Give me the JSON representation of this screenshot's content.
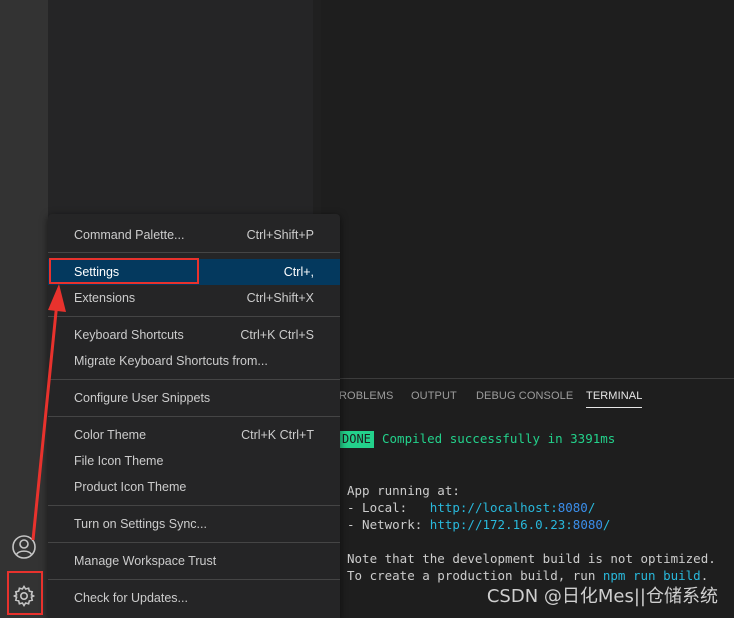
{
  "menu": {
    "items": [
      {
        "label": "Command Palette...",
        "key": "Ctrl+Shift+P"
      },
      {
        "label": "Settings",
        "key": "Ctrl+,"
      },
      {
        "label": "Extensions",
        "key": "Ctrl+Shift+X"
      },
      {
        "label": "Keyboard Shortcuts",
        "key": "Ctrl+K Ctrl+S"
      },
      {
        "label": "Migrate Keyboard Shortcuts from...",
        "key": ""
      },
      {
        "label": "Configure User Snippets",
        "key": ""
      },
      {
        "label": "Color Theme",
        "key": "Ctrl+K Ctrl+T"
      },
      {
        "label": "File Icon Theme",
        "key": ""
      },
      {
        "label": "Product Icon Theme",
        "key": ""
      },
      {
        "label": "Turn on Settings Sync...",
        "key": ""
      },
      {
        "label": "Manage Workspace Trust",
        "key": ""
      },
      {
        "label": "Check for Updates...",
        "key": ""
      }
    ],
    "selected_label": "Settings"
  },
  "panel": {
    "tabs": [
      "ROBLEMS",
      "OUTPUT",
      "DEBUG CONSOLE",
      "TERMINAL"
    ],
    "active_tab": "TERMINAL"
  },
  "terminal": {
    "done_badge": "DONE",
    "compiled": "Compiled successfully in 3391ms",
    "app_running": "App running at:",
    "local_label": "- Local:   ",
    "local_url_prefix": "http://localhost:",
    "local_port": "8080",
    "local_slash": "/",
    "network_label": "- Network: ",
    "network_url_prefix": "http://172.16.0.23:",
    "network_port": "8080",
    "network_slash": "/",
    "note_line": "Note that the development build is not optimized.",
    "prod_prefix": "To create a production build, run ",
    "prod_cmd": "npm run build",
    "prod_suffix": "."
  },
  "watermark": "CSDN @日化Mes||仓储系统",
  "icons": {
    "account": "account-icon",
    "manage": "gear-icon"
  },
  "colors": {
    "annotation": "#e8322d",
    "selection": "#04395e",
    "done_green": "#23d18b",
    "link_blue": "#29b8db"
  }
}
